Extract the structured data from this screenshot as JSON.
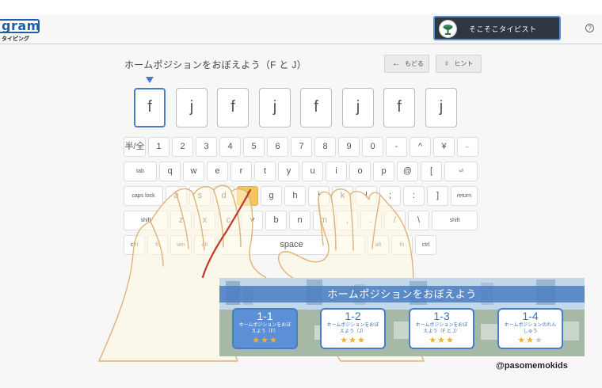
{
  "header": {
    "logo_text": "gram",
    "logo_sub": "タイピング",
    "rank_label": "そこそこタイピスト",
    "help_icon": "question-circle-icon"
  },
  "lesson": {
    "title": "ホームポジションをおぼえよう（F と J）",
    "back_button": "もどる",
    "back_icon": "arrow-left-icon",
    "hint_button": "ヒント",
    "hint_icon": "lightbulb-icon",
    "targets": [
      "f",
      "j",
      "f",
      "j",
      "f",
      "j",
      "f",
      "j"
    ],
    "current_index": 0
  },
  "keyboard": {
    "highlight_color": "#f2c65a",
    "row1": [
      "半/全",
      "1",
      "2",
      "3",
      "4",
      "5",
      "6",
      "7",
      "8",
      "9",
      "0",
      "-",
      "^",
      "¥",
      "←"
    ],
    "row2": [
      "tab",
      "q",
      "w",
      "e",
      "r",
      "t",
      "y",
      "u",
      "i",
      "o",
      "p",
      "@",
      "[",
      "⏎"
    ],
    "row3": [
      "caps lock",
      "a",
      "s",
      "d",
      "f",
      "g",
      "h",
      "j",
      "k",
      "l",
      ";",
      ":",
      "]",
      "return"
    ],
    "row4": [
      "shift",
      "z",
      "x",
      "c",
      "v",
      "b",
      "n",
      "m",
      ",",
      ".",
      "/",
      "\\",
      "shift"
    ],
    "row5": [
      "ctrl",
      "fn",
      "win",
      "alt",
      "space",
      "alt",
      "fn",
      "ctrl"
    ],
    "highlighted_key": "f"
  },
  "panel": {
    "title": "ホームポジションをおぼえよう",
    "lessons": [
      {
        "num": "1-1",
        "name": "ホームポジションをおぼえよう（F）",
        "stars": 3,
        "selected": true
      },
      {
        "num": "1-2",
        "name": "ホームポジションをおぼえよう（J）",
        "stars": 3,
        "selected": false
      },
      {
        "num": "1-3",
        "name": "ホームポジションをおぼえよう（F と J）",
        "stars": 3,
        "selected": false
      },
      {
        "num": "1-4",
        "name": "ホームポジションのれんしゅう",
        "stars": 2,
        "selected": false
      }
    ]
  },
  "watermark": "@pasomemokids",
  "colors": {
    "accent": "#4a7ec2",
    "badge_bg": "#2e3742",
    "star": "#e8b23a",
    "hand_stroke": "#e0b27a",
    "finger_path": "#c0392b"
  }
}
